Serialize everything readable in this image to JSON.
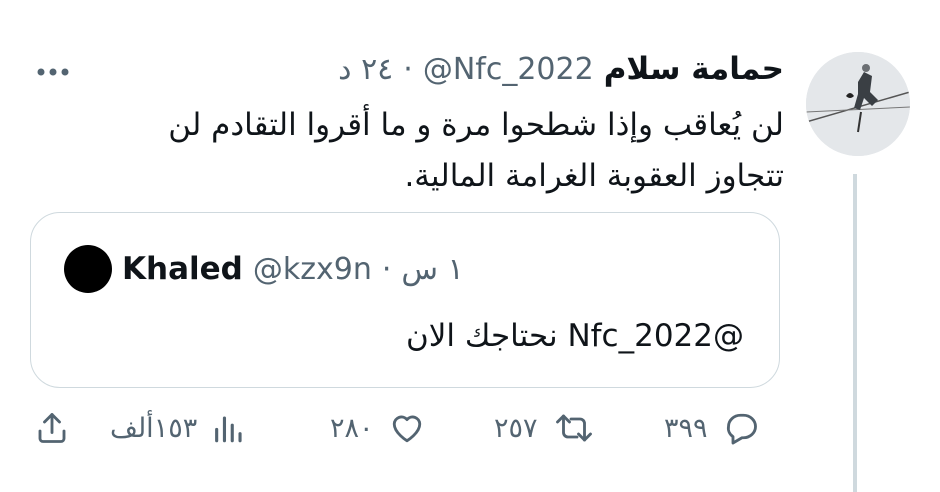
{
  "tweet": {
    "author_name": "حمامة سلام",
    "handle": "@Nfc_2022",
    "separator": "·",
    "time": "٢٤ د",
    "text": "لن يُعاقب وإذا شطحوا مرة و ما أقروا التقادم لن تتجاوز العقوبة الغرامة المالية."
  },
  "quoted_tweet": {
    "author_name": "Khaled",
    "handle": "@kzx9n",
    "separator": "·",
    "time": "١ س",
    "text": "@Nfc_2022 نحتاجك الان"
  },
  "actions": {
    "replies": "٣٩٩",
    "retweets": "٢٥٧",
    "likes": "٢٨٠",
    "views": "١٥٣ألف"
  },
  "colors": {
    "text": "#0f1419",
    "secondary": "#536471",
    "border": "#cfd9de"
  },
  "icons": {
    "more": "more-horizontal-icon",
    "reply": "reply-bubble-icon",
    "retweet": "retweet-icon",
    "like": "heart-icon",
    "views": "bar-chart-icon",
    "share": "share-upload-icon"
  }
}
